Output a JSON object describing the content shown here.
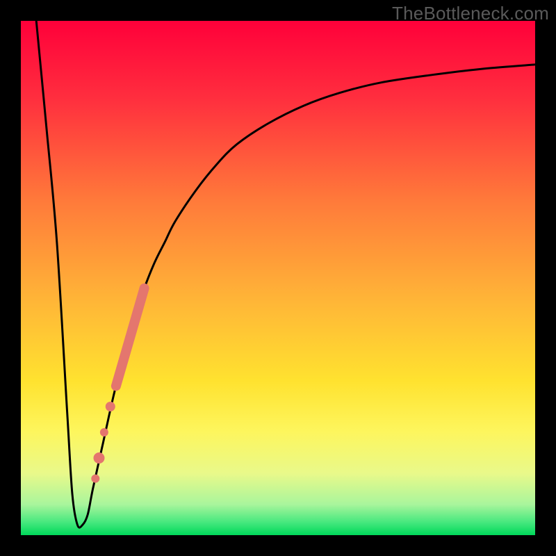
{
  "watermark": "TheBottleneck.com",
  "colors": {
    "frame": "#000000",
    "curve": "#000000",
    "dots": "#e4766e",
    "gradient_stops": [
      {
        "offset": 0.0,
        "color": "#ff003a"
      },
      {
        "offset": 0.15,
        "color": "#ff2e3e"
      },
      {
        "offset": 0.35,
        "color": "#ff7a3a"
      },
      {
        "offset": 0.55,
        "color": "#ffb737"
      },
      {
        "offset": 0.7,
        "color": "#ffe22f"
      },
      {
        "offset": 0.8,
        "color": "#fdf65e"
      },
      {
        "offset": 0.88,
        "color": "#e9f98a"
      },
      {
        "offset": 0.94,
        "color": "#a9f59c"
      },
      {
        "offset": 0.975,
        "color": "#46e87e"
      },
      {
        "offset": 1.0,
        "color": "#00d85a"
      }
    ]
  },
  "chart_data": {
    "type": "line",
    "title": "",
    "xlabel": "",
    "ylabel": "",
    "xlim": [
      0,
      100
    ],
    "ylim": [
      0,
      100
    ],
    "curve": {
      "comment": "y as a function of x (0-100). Descends steeply from 100 at x≈3, hits floor ≈2 at x≈11, then rises asymptotically toward ~92.",
      "x": [
        3,
        5,
        7,
        9,
        10,
        11,
        12,
        13,
        14,
        16,
        18,
        20,
        22,
        24,
        26,
        28,
        30,
        34,
        38,
        42,
        48,
        55,
        62,
        70,
        80,
        90,
        100
      ],
      "y": [
        100,
        79,
        57,
        24,
        8,
        2,
        2,
        4,
        9,
        18,
        27,
        35,
        42,
        48,
        53,
        57,
        61,
        67,
        72,
        76,
        80,
        83.5,
        86,
        88,
        89.5,
        90.7,
        91.5
      ]
    },
    "overlay_segment": {
      "comment": "Thick salmon segment overlaid on the rising curve between roughly x 18.5–24, y 29–48",
      "x1": 18.5,
      "y1": 29,
      "x2": 24.0,
      "y2": 48,
      "width": 14
    },
    "overlay_dots": [
      {
        "x": 17.4,
        "y": 25,
        "r": 7
      },
      {
        "x": 16.2,
        "y": 20,
        "r": 6
      },
      {
        "x": 15.2,
        "y": 15,
        "r": 8
      },
      {
        "x": 14.5,
        "y": 11,
        "r": 6
      }
    ]
  }
}
